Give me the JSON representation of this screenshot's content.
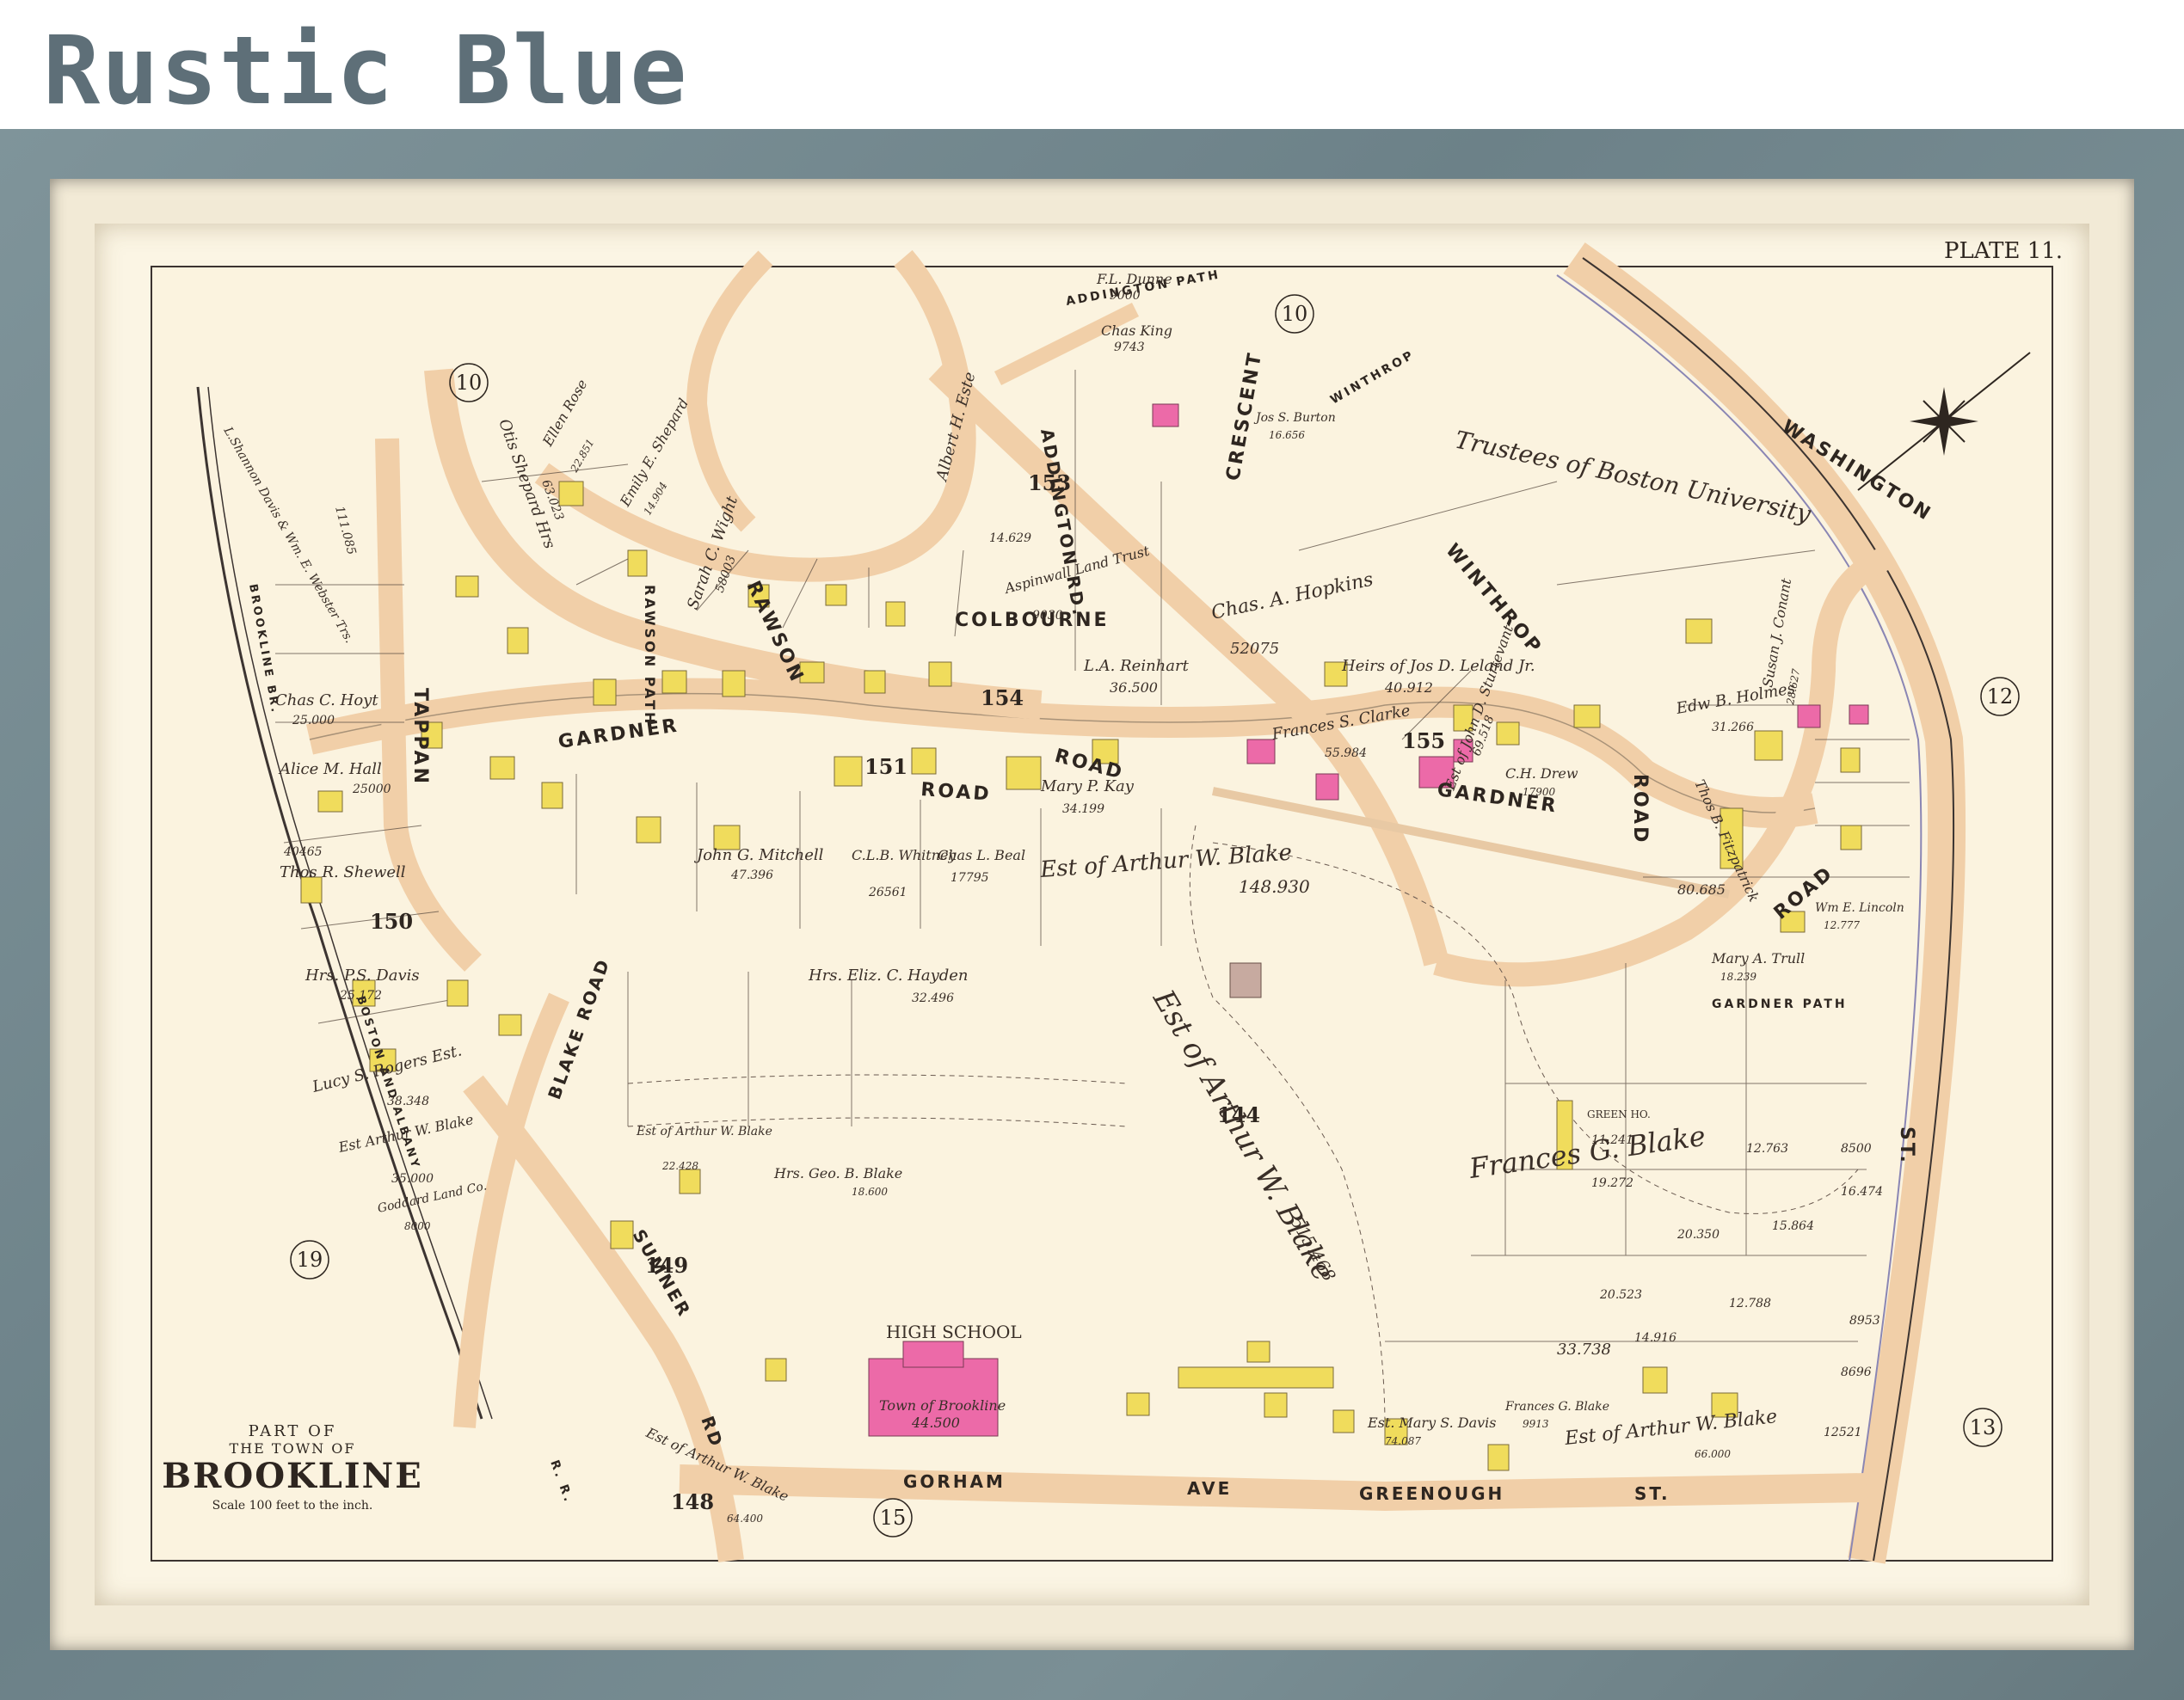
{
  "brand": "Rustic Blue",
  "map": {
    "plate": "PLATE 11.",
    "cartouche": {
      "line1": "PART OF",
      "line2": "THE TOWN OF",
      "town": "BROOKLINE",
      "scale": "Scale 100 feet to the inch."
    },
    "blocks": [
      "10",
      "10",
      "12",
      "13",
      "15",
      "19",
      "144",
      "148",
      "149",
      "150",
      "151",
      "153",
      "154",
      "155"
    ],
    "roads": {
      "washington": "WASHINGTON",
      "st": "ST.",
      "winthrop": "WINTHROP",
      "winthrop_small": "WINTHROP",
      "road": "ROAD",
      "crescent": "CRESCENT",
      "addington_rd": "ADDINGTON RD.",
      "addington_path": "ADDINGTON PATH",
      "colbourne": "COLBOURNE",
      "rawson": "RAWSON",
      "rawson_path": "RAWSON PATH",
      "gardner": "GARDNER",
      "gardner_path": "GARDNER PATH",
      "tappan": "TAPPAN",
      "blake_road": "BLAKE ROAD",
      "sumner": "SUMNER",
      "rd": "RD",
      "gorham": "GORHAM",
      "ave": "AVE",
      "greenough": "GREENOUGH",
      "brookline_br": "BROOKLINE BR.",
      "boston_and_albany": "BOSTON AND ALBANY",
      "rr": "R. R."
    },
    "owners": {
      "trustees": "Trustees of Boston University",
      "est_blake_large": "Est of Arthur W. Blake",
      "est_blake_area": "515.468",
      "est_blake_middle": "Est of Arthur W. Blake",
      "est_blake_middle_area": "148.930",
      "frances_blake": "Frances G. Blake",
      "frances_area": "33.738",
      "high_school": "HIGH SCHOOL",
      "town_of_brookline": "Town of Brookline",
      "hs_area": "44.500",
      "green_ho": "GREEN HO.",
      "chas_hopkins": "Chas. A. Hopkins",
      "chas_hopkins_area": "52075",
      "heirs_leland": "Heirs of Jos D. Leland Jr.",
      "heirs_leland_area": "40.912",
      "est_sturtevant": "Est of John D. Sturtevant",
      "est_sturtevant_area": "69.518",
      "frances_clarke": "Frances S. Clarke",
      "frances_clarke_area": "55.984",
      "la_reinhart": "L.A. Reinhart",
      "la_reinhart_area": "36.500",
      "mary_kay": "Mary P. Kay",
      "mary_kay_area": "34.199",
      "john_mitchell": "John G. Mitchell",
      "john_mitchell_area": "47.396",
      "clb_whitney": "C.L.B. Whitney",
      "clb_whitney_area": "26561",
      "chas_beal": "Chas L. Beal",
      "chas_beal_area": "17795",
      "mrs_hayden": "Hrs. Eliz. C. Hayden",
      "mrs_hayden_area": "32.496",
      "chas_hoyt": "Chas C. Hoyt",
      "chas_hoyt_area": "25.000",
      "alice_hall": "Alice M. Hall",
      "alice_hall_area": "25000",
      "thos_shewell": "Thos R. Shewell",
      "thos_shewell_area": "40465",
      "mrs_davis": "Hrs. P.S. Davis",
      "mrs_davis_area": "25.172",
      "lucy_rogers": "Lucy S. Rogers Est.",
      "lucy_rogers_area": "38.348",
      "est_blake_small": "Est Arthur W. Blake",
      "est_blake_small_area": "35.000",
      "goddard_land": "Goddard Land Co.",
      "goddard_land_area": "8000",
      "davis_webster": "L.Shannon Davis & Wm. E. Webster Trs.",
      "davis_webster_area": "111.085",
      "otis_shepard": "Otis Shepard Hrs",
      "otis_shepard_area": "63.023",
      "sarah_wight": "Sarah C. Wight",
      "sarah_wight_area": "58003",
      "ellen_rose": "Ellen Rose",
      "ellen_rose_area": "22.851",
      "emily_shepard": "Emily E. Shepard",
      "emily_shepard_area": "14.904",
      "albert_este": "Albert H. Este",
      "albert_este_area": "14.629",
      "aspinwall": "Aspinwall Land Trust",
      "aspinwall_area": "9030",
      "fl_dunne": "F.L. Dunne",
      "fl_dunne_area": "9000",
      "chas_king": "Chas King",
      "chas_king_area": "9743",
      "jos_burton": "Jos S. Burton",
      "jos_burton_area": "16.656",
      "edw_holmes": "Edw B. Holmes",
      "edw_holmes_area": "31.266",
      "susan_conant": "Susan J. Conant",
      "susan_conant_area": "28.627",
      "thos_fitzpatrick": "Thos B. Fitzpatrick",
      "thos_fitzpatrick_area": "80.685",
      "ch_drew": "C.H. Drew",
      "ch_drew_area": "17900",
      "mary_trull": "Mary A. Trull",
      "mary_trull_area": "18.239",
      "wm_lincoln": "Wm E. Lincoln",
      "wm_lincoln_area": "12.777",
      "mary_davis": "Est. Mary S. Davis",
      "mary_davis_area": "74.087",
      "frances_blake_lot": "Frances G. Blake",
      "frances_blake_lot_area": "9913",
      "est_blake_south": "Est of Arthur W. Blake",
      "est_blake_south_area": "66.000",
      "mrs_geo_blake": "Hrs. Geo. B. Blake",
      "mrs_geo_blake_area": "18.600",
      "est_blake_sw": "Est of Arthur W. Blake",
      "est_blake_sw_area": "22.428",
      "est_blake_148": "Est of Arthur W. Blake",
      "est_blake_148_area": "64.400"
    },
    "lot_numbers": [
      "19.272",
      "12.763",
      "8500",
      "16.474",
      "11.241",
      "20.350",
      "15.864",
      "20.523",
      "12.788",
      "14.916",
      "8953",
      "8696",
      "12521"
    ]
  }
}
